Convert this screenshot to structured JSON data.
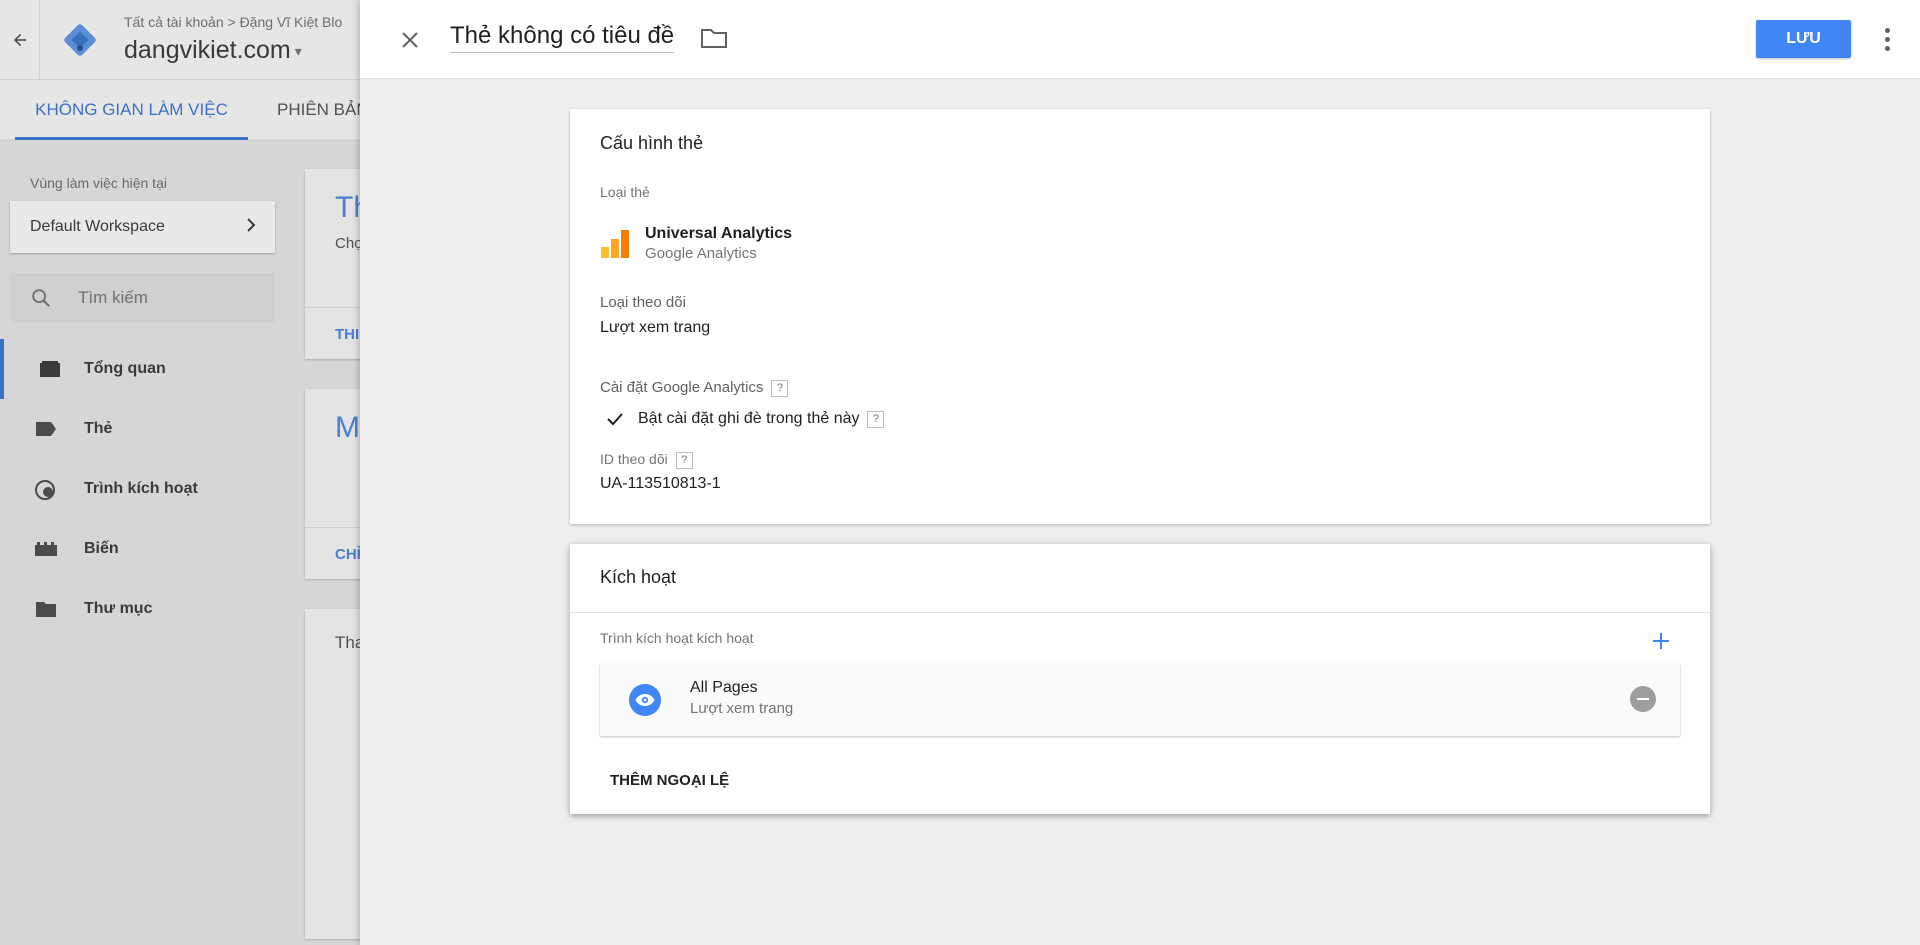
{
  "background": {
    "back_icon": "arrow-back-icon",
    "logo_icon": "gtm-diamond-logo",
    "breadcrumb": "Tất cả tài khoản  >  Đặng Vĩ Kiệt Blo",
    "account_name": "dangvikiet.com",
    "account_caret": "▾",
    "tabs": [
      {
        "label": "KHÔNG GIAN LÀM VIỆC"
      },
      {
        "label": "PHIÊN BẢN"
      }
    ],
    "workspace_label": "Vùng làm việc hiện tại",
    "workspace_name": "Default Workspace",
    "search_placeholder": "Tìm kiếm",
    "nav": [
      {
        "label": "Tổng quan",
        "icon": "overview-icon"
      },
      {
        "label": "Thẻ",
        "icon": "tag-icon"
      },
      {
        "label": "Trình kích hoạt",
        "icon": "trigger-icon"
      },
      {
        "label": "Biến",
        "icon": "variable-icon"
      },
      {
        "label": "Thư mục",
        "icon": "folder-icon"
      }
    ],
    "cards": [
      {
        "big": "Th",
        "small": "Chọ",
        "link": "THI"
      },
      {
        "big": "M",
        "link": "CHỈ"
      },
      {
        "small": "Tha"
      }
    ]
  },
  "panel": {
    "title": "Thẻ không có tiêu đề",
    "save_label": "LƯU",
    "config": {
      "title": "Cấu hình thẻ",
      "tag_type_label": "Loại thẻ",
      "tag_type_name": "Universal Analytics",
      "tag_type_sub": "Google Analytics",
      "track_type_label": "Loại theo dõi",
      "track_type_value": "Lượt xem trang",
      "ga_settings_label": "Cài đặt Google Analytics",
      "override_label": "Bật cài đặt ghi đè trong thẻ này",
      "override_checked": true,
      "tracking_id_label": "ID theo dõi",
      "tracking_id_value": "UA-113510813-1",
      "help_glyph": "?"
    },
    "triggering": {
      "title": "Kích hoạt",
      "section_label": "Trình kích hoạt kích hoạt",
      "triggers": [
        {
          "name": "All Pages",
          "type": "Lượt xem trang",
          "icon": "eye-icon"
        }
      ],
      "add_exception_label": "THÊM NGOẠI LỆ"
    }
  },
  "colors": {
    "accent": "#4285f4",
    "tab_active": "#3b72c6",
    "ga_yellow": "#fbc02d",
    "ga_orange": "#f57c00"
  }
}
